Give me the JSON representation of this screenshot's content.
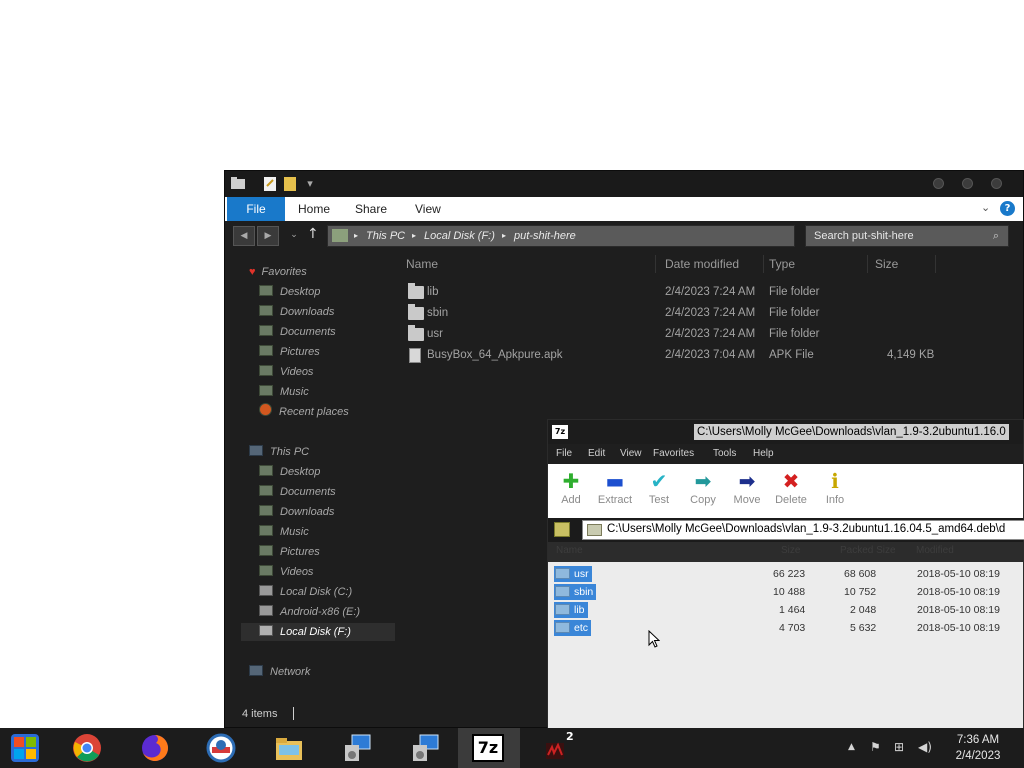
{
  "explorer": {
    "ribbon": {
      "tabs": [
        "File",
        "Home",
        "Share",
        "View"
      ]
    },
    "address": {
      "segments": [
        "This PC",
        "Local Disk (F:)",
        "put-shit-here"
      ]
    },
    "search": {
      "placeholder": "Search put-shit-here"
    },
    "nav": {
      "favorites": {
        "label": "Favorites",
        "items": [
          "Desktop",
          "Downloads",
          "Documents",
          "Pictures",
          "Videos",
          "Music",
          "Recent places"
        ]
      },
      "this_pc": {
        "label": "This PC",
        "items": [
          "Desktop",
          "Documents",
          "Downloads",
          "Music",
          "Pictures",
          "Videos",
          "Local Disk (C:)",
          "Android-x86 (E:)",
          "Local Disk (F:)"
        ]
      },
      "network": {
        "label": "Network"
      }
    },
    "columns": [
      "Name",
      "Date modified",
      "Type",
      "Size"
    ],
    "files": [
      {
        "name": "lib",
        "date": "2/4/2023 7:24 AM",
        "type": "File folder",
        "size": "",
        "icon": "folder-icon"
      },
      {
        "name": "sbin",
        "date": "2/4/2023 7:24 AM",
        "type": "File folder",
        "size": "",
        "icon": "folder-icon"
      },
      {
        "name": "usr",
        "date": "2/4/2023 7:24 AM",
        "type": "File folder",
        "size": "",
        "icon": "folder-icon"
      },
      {
        "name": "BusyBox_64_Apkpure.apk",
        "date": "2/4/2023 7:04 AM",
        "type": "APK File",
        "size": "4,149 KB",
        "icon": "file-icon"
      }
    ],
    "status": {
      "item_count": "4 items"
    }
  },
  "sevenzip": {
    "title": "C:\\Users\\Molly McGee\\Downloads\\vlan_1.9-3.2ubuntu1.16.0",
    "logo": "7z",
    "menu": [
      "File",
      "Edit",
      "View",
      "Favorites",
      "Tools",
      "Help"
    ],
    "toolbar": [
      {
        "label": "Add",
        "glyph": "✚",
        "color": "#2fae2f"
      },
      {
        "label": "Extract",
        "glyph": "▬",
        "color": "#1c4fcf"
      },
      {
        "label": "Test",
        "glyph": "✔",
        "color": "#27b3c6"
      },
      {
        "label": "Copy",
        "glyph": "➡",
        "color": "#22989b"
      },
      {
        "label": "Move",
        "glyph": "➡",
        "color": "#1d2f8c"
      },
      {
        "label": "Delete",
        "glyph": "✖",
        "color": "#d42020"
      },
      {
        "label": "Info",
        "glyph": "ℹ",
        "color": "#c7a700"
      }
    ],
    "path": "C:\\Users\\Molly McGee\\Downloads\\vlan_1.9-3.2ubuntu1.16.04.5_amd64.deb\\d",
    "columns": [
      "Name",
      "Size",
      "Packed Size",
      "Modified"
    ],
    "rows": [
      {
        "name": "usr",
        "size": "66 223",
        "packed": "68 608",
        "modified": "2018-05-10 08:19"
      },
      {
        "name": "sbin",
        "size": "10 488",
        "packed": "10 752",
        "modified": "2018-05-10 08:19"
      },
      {
        "name": "lib",
        "size": "1 464",
        "packed": "2 048",
        "modified": "2018-05-10 08:19"
      },
      {
        "name": "etc",
        "size": "4 703",
        "packed": "5 632",
        "modified": "2018-05-10 08:19"
      }
    ]
  },
  "taskbar": {
    "apps": [
      "start",
      "chrome",
      "firefox",
      "opera",
      "file-explorer",
      "installer-1",
      "installer-2",
      "7-zip",
      "notepad"
    ],
    "badge": "2",
    "sevenzip_label": "7z",
    "clock": {
      "time": "7:36 AM",
      "date": "2/4/2023"
    }
  }
}
